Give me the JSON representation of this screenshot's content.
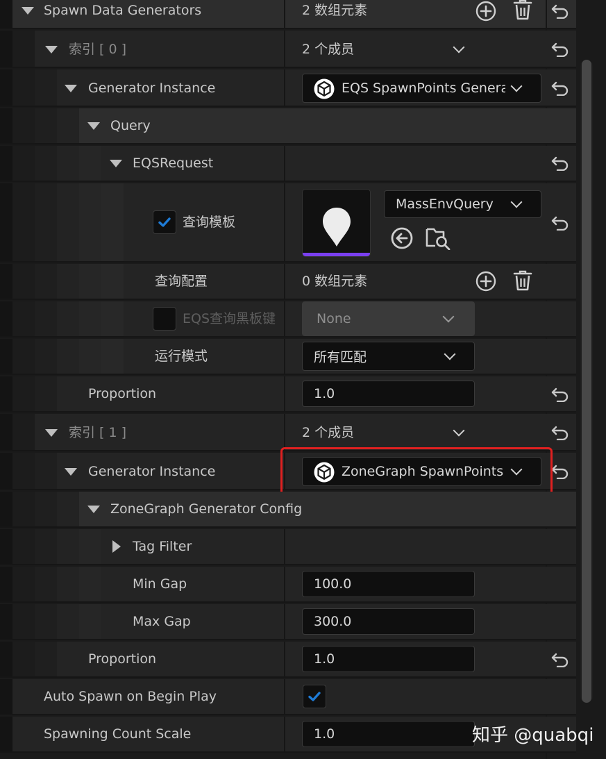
{
  "spawn_data_generators": {
    "label": "Spawn Data Generators",
    "value": "2 数组元素"
  },
  "index0": {
    "label": "索引 [ 0 ]",
    "value": "2 个成员"
  },
  "generator_instance_0": {
    "label": "Generator Instance",
    "value": "EQS SpawnPoints Generator"
  },
  "query": {
    "label": "Query"
  },
  "eqs_request": {
    "label": "EQSRequest"
  },
  "query_template": {
    "label": "查询模板",
    "checked": true,
    "asset": "MassEnvQuery"
  },
  "query_config": {
    "label": "查询配置",
    "value": "0 数组元素"
  },
  "eqs_blackboard_key": {
    "label": "EQS查询黑板键",
    "value": "None",
    "checked": false
  },
  "run_mode": {
    "label": "运行模式",
    "value": "所有匹配"
  },
  "proportion_0": {
    "label": "Proportion",
    "value": "1.0"
  },
  "index1": {
    "label": "索引 [ 1 ]",
    "value": "2 个成员"
  },
  "generator_instance_1": {
    "label": "Generator Instance",
    "value": "ZoneGraph SpawnPoints"
  },
  "zonegraph_config": {
    "label": "ZoneGraph Generator Config"
  },
  "tag_filter": {
    "label": "Tag Filter"
  },
  "min_gap": {
    "label": "Min Gap",
    "value": "100.0"
  },
  "max_gap": {
    "label": "Max Gap",
    "value": "300.0"
  },
  "proportion_1": {
    "label": "Proportion",
    "value": "1.0"
  },
  "auto_spawn": {
    "label": "Auto Spawn on Begin Play",
    "checked": true
  },
  "spawning_count_scale": {
    "label": "Spawning Count Scale",
    "value": "1.0"
  },
  "watermark": "知乎 @quabqi",
  "colors": {
    "accent": "#1e7bd6",
    "highlight": "#e02020",
    "thumbnail_bar": "#7a3ff0"
  }
}
